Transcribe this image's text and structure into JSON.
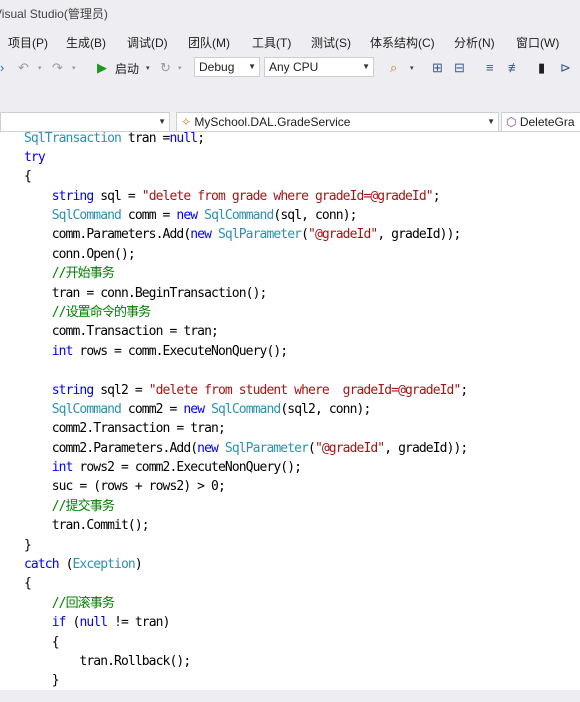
{
  "window": {
    "title": "Visual Studio(管理员)"
  },
  "menu": [
    {
      "label": "项目(P)"
    },
    {
      "label": "生成(B)"
    },
    {
      "label": "调试(D)"
    },
    {
      "label": "团队(M)"
    },
    {
      "label": "工具(T)"
    },
    {
      "label": "测试(S)"
    },
    {
      "label": "体系结构(C)"
    },
    {
      "label": "分析(N)"
    },
    {
      "label": "窗口(W)"
    }
  ],
  "toolbar": {
    "start_label": "启动",
    "configuration": "Debug",
    "platform": "Any CPU"
  },
  "nav": {
    "class_combo": "MySchool.DAL.GradeService",
    "member_combo": "DeleteGra"
  },
  "code": [
    "SqlTransaction tran =null;",
    "try",
    "{",
    "    string sql = \"delete from grade where gradeId=@gradeId\";",
    "    SqlCommand comm = new SqlCommand(sql, conn);",
    "    comm.Parameters.Add(new SqlParameter(\"@gradeId\", gradeId));",
    "    conn.Open();",
    "    //开始事务",
    "    tran = conn.BeginTransaction();",
    "    //设置命令的事务",
    "    comm.Transaction = tran;",
    "    int rows = comm.ExecuteNonQuery();",
    "",
    "    string sql2 = \"delete from student where  gradeId=@gradeId\";",
    "    SqlCommand comm2 = new SqlCommand(sql2, conn);",
    "    comm2.Transaction = tran;",
    "    comm2.Parameters.Add(new SqlParameter(\"@gradeId\", gradeId));",
    "    int rows2 = comm2.ExecuteNonQuery();",
    "    suc = (rows + rows2) > 0;",
    "    //提交事务",
    "    tran.Commit();",
    "}",
    "catch (Exception)",
    "{",
    "    //回滚事务",
    "    if (null != tran)",
    "    {",
    "        tran.Rollback();",
    "    }"
  ],
  "colors": {
    "keyword": "#0000ff",
    "type": "#2b91af",
    "string": "#a31515",
    "comment": "#008000"
  }
}
